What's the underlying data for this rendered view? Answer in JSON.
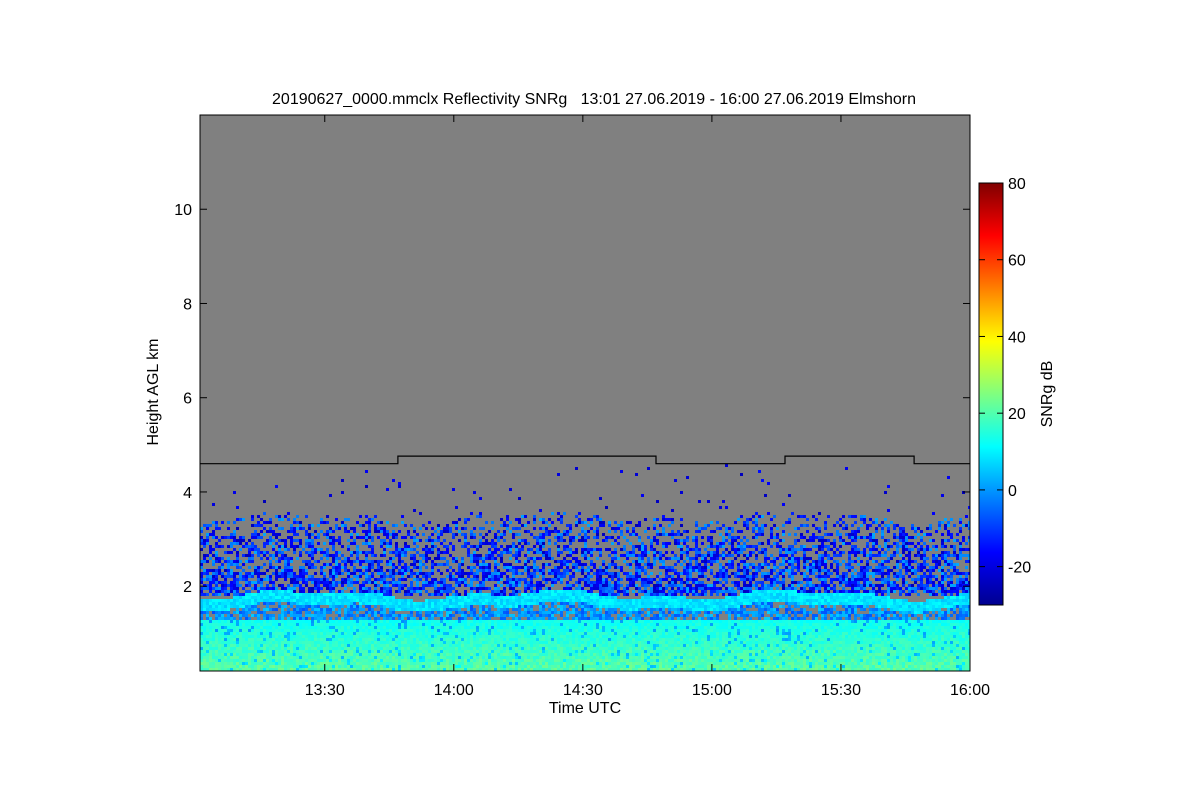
{
  "chart_data": {
    "type": "heatmap",
    "title": "20190627_0000.mmclx Reflectivity SNRg   13:01 27.06.2019 - 16:00 27.06.2019 Elmshorn",
    "xlabel": "Time UTC",
    "ylabel": "Height AGL km",
    "x_range": [
      "13:01",
      "16:00"
    ],
    "x_ticks": [
      "13:30",
      "14:00",
      "14:30",
      "15:00",
      "15:30",
      "16:00"
    ],
    "ylim": [
      0.2,
      12
    ],
    "y_ticks": [
      2,
      4,
      6,
      8,
      10
    ],
    "colorbar": {
      "label": "SNRg dB",
      "range": [
        -30,
        80
      ],
      "ticks": [
        -20,
        0,
        20,
        40,
        60,
        80
      ]
    },
    "background_color": "#808080",
    "range_limit_line": {
      "description": "upper range limit",
      "times": [
        "13:01",
        "13:47",
        "13:47",
        "14:47",
        "14:47",
        "15:17",
        "15:17",
        "15:47",
        "15:47",
        "16:00"
      ],
      "heights": [
        4.6,
        4.6,
        4.76,
        4.76,
        4.6,
        4.6,
        4.76,
        4.76,
        4.6,
        4.6
      ]
    },
    "signal_features": [
      {
        "description": "surface layer echo",
        "height_range": [
          0.2,
          1.3
        ],
        "snr_db": [
          5,
          25
        ]
      },
      {
        "description": "bright band",
        "height_range": [
          1.6,
          1.85
        ],
        "snr_db": [
          5,
          12
        ]
      },
      {
        "description": "scattered echo",
        "height_range": [
          1.85,
          3.5
        ],
        "snr_db": [
          -25,
          2
        ]
      },
      {
        "description": "sparse noise",
        "height_range": [
          3.5,
          4.6
        ],
        "snr_db": [
          -25,
          -15
        ]
      }
    ],
    "colormap": "jet"
  }
}
